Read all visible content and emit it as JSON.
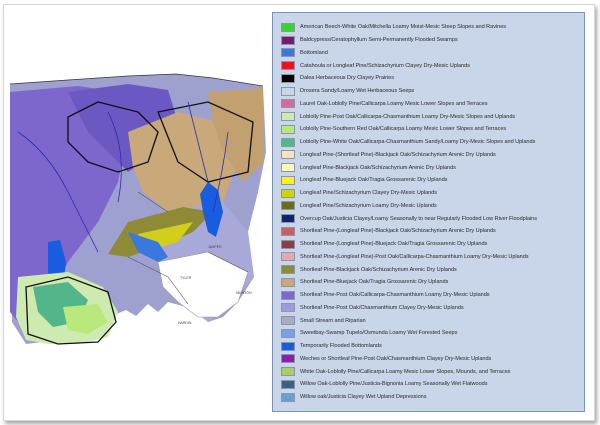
{
  "map": {
    "town_labels": [
      "TYLER",
      "JASPER",
      "HARDIN",
      "NEWTON"
    ]
  },
  "legend": {
    "items": [
      {
        "label": "American Beech-White Oak/Mitchella Loamy Moist-Mesic Steep Slopes and Ravines",
        "color": "#33d629"
      },
      {
        "label": "Baldcypress/Ceratophyllum Semi-Permanently Flooded Swamps",
        "color": "#7a1a6e"
      },
      {
        "label": "Bottomland",
        "color": "#3a78e0"
      },
      {
        "label": "Catahoula or Longleaf Pine/Schizachyrium Clayey Dry-Mesic Uplands",
        "color": "#e01919"
      },
      {
        "label": "Dalea Herbaceous Dry Clayey Prairies",
        "color": "#000000"
      },
      {
        "label": "Drosera Sandy/Loamy Wet Herbaceous Seeps",
        "color": "#c9d6ea"
      },
      {
        "label": "Laurel Oak-Loblolly Pine/Callicarpa Loamy Mesic Lower Slopes and Terraces",
        "color": "#d96aa0"
      },
      {
        "label": "Loblolly Pine-Post Oak/Callicarpa-Chasmanthium Loamy Dry-Mesic Slopes and Uplands",
        "color": "#cfeab0"
      },
      {
        "label": "Loblolly Pine-Southern Red Oak/Callicarpa Loamy Mesic Lower Slopes and Terraces",
        "color": "#b9e87d"
      },
      {
        "label": "Loblolly Pine-White Oak/Callicarpa-Chasmanthium Sandy/Loamy Dry-Mesic Slopes and Uplands",
        "color": "#52b68a"
      },
      {
        "label": "Longleaf Pine-(Shortleaf Pine)-Blackjack Oak/Schizachyrium Arenic Dry Uplands",
        "color": "#f6e4c0"
      },
      {
        "label": "Longleaf Pine-Blackjack Oak/Schizachyrium Arenic Dry Uplands",
        "color": "#fbf9b8"
      },
      {
        "label": "Longleaf Pine-Bluejack Oak/Tragia Grossarenic Dry Uplands",
        "color": "#fbf21a"
      },
      {
        "label": "Longleaf Pine/Schizachyrium Clayey Dry-Mesic Uplands",
        "color": "#d2cf1a"
      },
      {
        "label": "Longleaf Pine/Schizachyrium Loamy Dry-Mesic Uplands",
        "color": "#6e6a1a"
      },
      {
        "label": "Overcup Oak/Justicia Clayey/Loamy Seasonally to near Regularly Flooded Low River Floodplains",
        "color": "#12236e"
      },
      {
        "label": "Shortleaf Pine-(Longleaf Pine)-Blackjack Oak/Schizachyrium Arenic Dry Uplands",
        "color": "#d15a68"
      },
      {
        "label": "Shortleaf Pine-(Longleaf Pine)-Bluejack Oak/Tragia Grossarenic Dry Uplands",
        "color": "#8a3f47"
      },
      {
        "label": "Shortleaf Pine-(Longleaf Pine)-Post Oak/Callicarpa-Chasmanthium Loamy Dry-Mesic Uplands",
        "color": "#e8a6ae"
      },
      {
        "label": "Shortleaf Pine-Blackjack Oak/Schizachyrium Arenic Dry Uplands",
        "color": "#8f8a35"
      },
      {
        "label": "Shortleaf Pine-Bluejack Oak/Tragia Grossarenic Dry Uplands",
        "color": "#c9a87a"
      },
      {
        "label": "Shortleaf Pine-Post Oak/Callicarpa-Chasmanthium Loamy Dry-Mesic Uplands",
        "color": "#7d66cc"
      },
      {
        "label": "Shortleaf Pine-Post Oak/Chasmanthium Clayey Dry-Mesic Uplands",
        "color": "#9f9ae0"
      },
      {
        "label": "Small Stream and Riparian",
        "color": "#a9aac4"
      },
      {
        "label": "Sweetbay-Swamp Tupelo/Osmunda Loamy Wet Forested Seeps",
        "color": "#7d9ee6"
      },
      {
        "label": "Temporarily Flooded Bottomlands",
        "color": "#1a5ce0"
      },
      {
        "label": "Weches or Shortleaf Pine-Post Oak/Chasmanthium Clayey Dry-Mesic Uplands",
        "color": "#8a1fa8"
      },
      {
        "label": "White Oak-Loblolly Pine/Callicarpa Loamy Mesic Lower Slopes, Mounds,  and Terraces",
        "color": "#a9cf62"
      },
      {
        "label": "Willow Oak-Loblolly Pine/Justicia-Bignonia Loamy Seasonally Wet Flatwoods",
        "color": "#3d5f86"
      },
      {
        "label": "Willow oak/Justicia Clayey Wet Upland Depressions",
        "color": "#6a9fd6"
      }
    ]
  }
}
